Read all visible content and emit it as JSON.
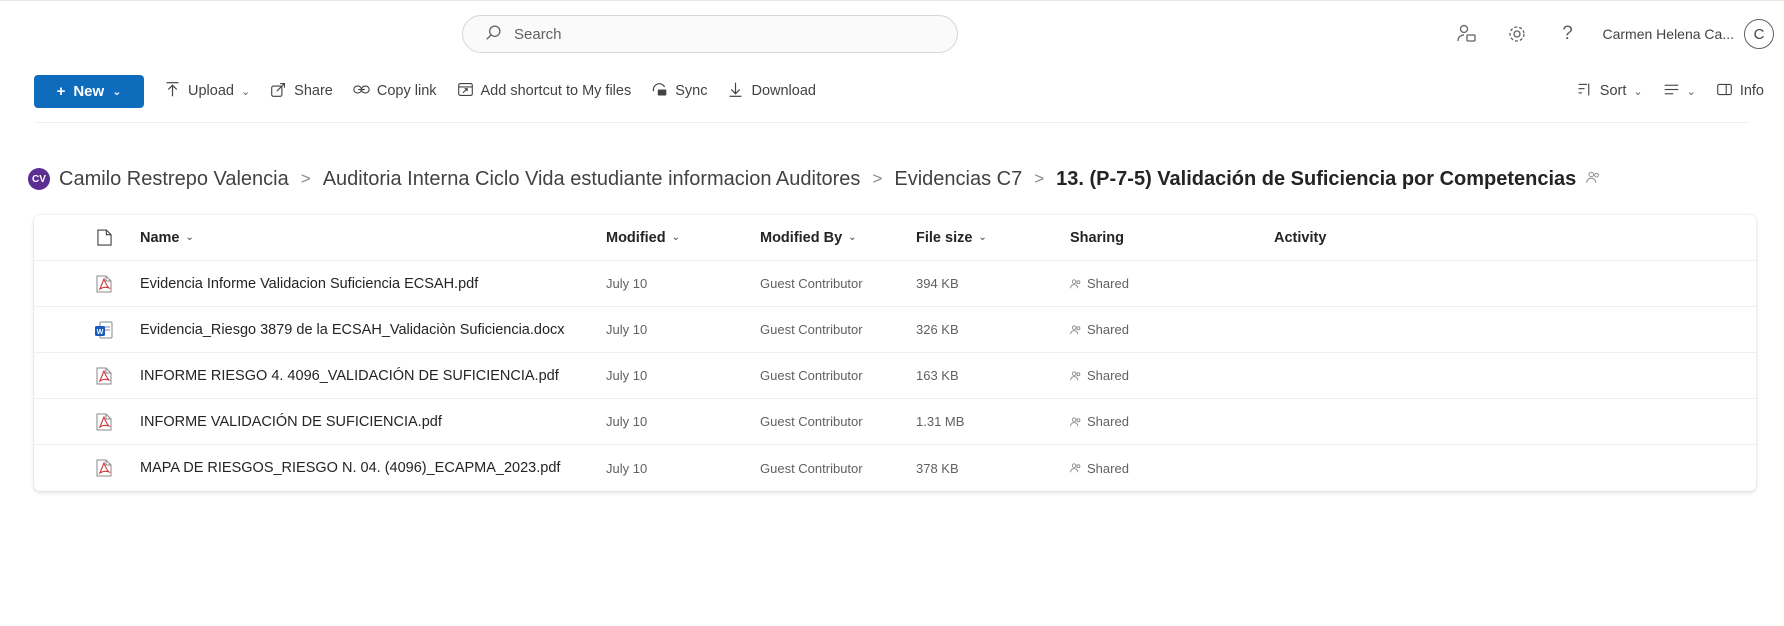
{
  "search": {
    "placeholder": "Search"
  },
  "user": {
    "name": "Carmen Helena Ca...",
    "initial": "C"
  },
  "new_button": {
    "label": "New"
  },
  "commands": [
    {
      "label": "Upload",
      "icon": "upload-icon",
      "has_dropdown": true
    },
    {
      "label": "Share",
      "icon": "share-icon",
      "has_dropdown": false
    },
    {
      "label": "Copy link",
      "icon": "link-icon",
      "has_dropdown": false
    },
    {
      "label": "Add shortcut to My files",
      "icon": "shortcut-icon",
      "has_dropdown": false
    },
    {
      "label": "Sync",
      "icon": "sync-icon",
      "has_dropdown": false
    },
    {
      "label": "Download",
      "icon": "download-icon",
      "has_dropdown": false
    }
  ],
  "right_commands": {
    "sort": "Sort",
    "info": "Info"
  },
  "breadcrumb": {
    "badge": "CV",
    "items": [
      "Camilo Restrepo Valencia",
      "Auditoria Interna Ciclo Vida estudiante informacion Auditores",
      "Evidencias C7"
    ],
    "current": "13. (P-7-5) Validación de Suficiencia por Competencias",
    "separator": ">"
  },
  "table": {
    "headers": {
      "name": "Name",
      "modified": "Modified",
      "modified_by": "Modified By",
      "file_size": "File size",
      "sharing": "Sharing",
      "activity": "Activity"
    },
    "rows": [
      {
        "type": "pdf",
        "name": "Evidencia Informe Validacion Suficiencia ECSAH.pdf",
        "modified": "July 10",
        "modified_by": "Guest Contributor",
        "size": "394 KB",
        "sharing": "Shared"
      },
      {
        "type": "docx",
        "name": "Evidencia_Riesgo 3879 de la ECSAH_Validaciòn Suficiencia.docx",
        "modified": "July 10",
        "modified_by": "Guest Contributor",
        "size": "326 KB",
        "sharing": "Shared"
      },
      {
        "type": "pdf",
        "name": "INFORME RIESGO 4. 4096_VALIDACIÓN DE SUFICIENCIA.pdf",
        "modified": "July 10",
        "modified_by": "Guest Contributor",
        "size": "163 KB",
        "sharing": "Shared"
      },
      {
        "type": "pdf",
        "name": "INFORME VALIDACIÓN DE SUFICIENCIA.pdf",
        "modified": "July 10",
        "modified_by": "Guest Contributor",
        "size": "1.31 MB",
        "sharing": "Shared"
      },
      {
        "type": "pdf",
        "name": "MAPA DE RIESGOS_RIESGO N. 04. (4096)_ECAPMA_2023.pdf",
        "modified": "July 10",
        "modified_by": "Guest Contributor",
        "size": "378 KB",
        "sharing": "Shared"
      }
    ]
  },
  "colors": {
    "accent": "#0f6cbd",
    "badge": "#5c2e91",
    "pdf": "#d13438",
    "word": "#185abd"
  }
}
